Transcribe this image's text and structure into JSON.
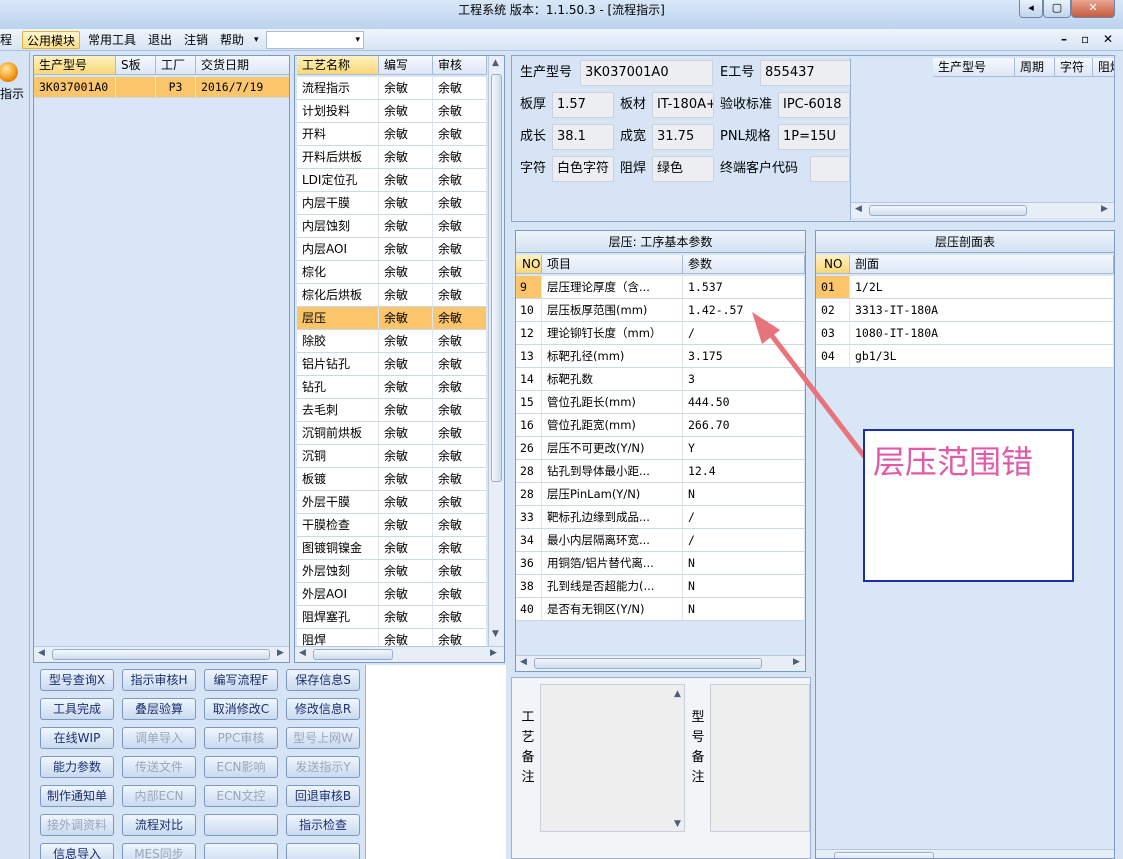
{
  "window": {
    "title": "工程系统  版本：1.1.50.3 - [流程指示]",
    "controls": [
      "◂",
      "▢",
      "✕"
    ]
  },
  "menu": {
    "items": [
      "程",
      "公用模块",
      "常用工具",
      "退出",
      "注销",
      "帮助"
    ],
    "combo_value": "",
    "mdi_controls": [
      "–",
      "▫",
      "✕"
    ]
  },
  "left_toolbar": {
    "label": "指示"
  },
  "order_table": {
    "columns": [
      "生产型号",
      "S板",
      "工厂",
      "交货日期"
    ],
    "rows": [
      [
        "3K037001A0",
        "",
        "P3",
        "2016/7/19"
      ]
    ]
  },
  "process_table": {
    "columns": [
      "工艺名称",
      "编写",
      "审核"
    ],
    "rows": [
      [
        "流程指示",
        "余敏",
        "余敏"
      ],
      [
        "计划投料",
        "余敏",
        "余敏"
      ],
      [
        "开料",
        "余敏",
        "余敏"
      ],
      [
        "开料后烘板",
        "余敏",
        "余敏"
      ],
      [
        "LDI定位孔",
        "余敏",
        "余敏"
      ],
      [
        "内层干膜",
        "余敏",
        "余敏"
      ],
      [
        "内层蚀刻",
        "余敏",
        "余敏"
      ],
      [
        "内层AOI",
        "余敏",
        "余敏"
      ],
      [
        "棕化",
        "余敏",
        "余敏"
      ],
      [
        "棕化后烘板",
        "余敏",
        "余敏"
      ],
      [
        "层压",
        "余敏",
        "余敏"
      ],
      [
        "除胶",
        "余敏",
        "余敏"
      ],
      [
        "铝片钻孔",
        "余敏",
        "余敏"
      ],
      [
        "钻孔",
        "余敏",
        "余敏"
      ],
      [
        "去毛刺",
        "余敏",
        "余敏"
      ],
      [
        "沉铜前烘板",
        "余敏",
        "余敏"
      ],
      [
        "沉铜",
        "余敏",
        "余敏"
      ],
      [
        "板镀",
        "余敏",
        "余敏"
      ],
      [
        "外层干膜",
        "余敏",
        "余敏"
      ],
      [
        "干膜检查",
        "余敏",
        "余敏"
      ],
      [
        "图镀铜镍金",
        "余敏",
        "余敏"
      ],
      [
        "外层蚀刻",
        "余敏",
        "余敏"
      ],
      [
        "外层AOI",
        "余敏",
        "余敏"
      ],
      [
        "阻焊塞孔",
        "余敏",
        "余敏"
      ],
      [
        "阻焊",
        "余敏",
        "余敏"
      ]
    ],
    "selected_index": 10
  },
  "buttons": [
    [
      "型号查询X",
      "指示审核H",
      "编写流程F",
      "保存信息S"
    ],
    [
      "工具完成",
      "叠层验算",
      "取消修改C",
      "修改信息R"
    ],
    [
      "在线WIP",
      "调单导入",
      "PPC审核",
      "型号上网W"
    ],
    [
      "能力参数",
      "传送文件",
      "ECN影响",
      "发送指示Y"
    ],
    [
      "制作通知单",
      "内部ECN",
      "ECN文控",
      "回退审核B"
    ],
    [
      "接外调资料",
      "流程对比",
      "",
      "指示检查"
    ],
    [
      "信息导入",
      "MES同步",
      "",
      ""
    ]
  ],
  "buttons_disabled": [
    [
      false,
      false,
      false,
      false
    ],
    [
      false,
      false,
      false,
      false
    ],
    [
      false,
      true,
      true,
      true
    ],
    [
      false,
      true,
      true,
      true
    ],
    [
      false,
      true,
      true,
      false
    ],
    [
      true,
      false,
      false,
      false
    ],
    [
      false,
      true,
      false,
      false
    ]
  ],
  "info": {
    "labels": {
      "model": "生产型号",
      "e_no": "E工号",
      "thickness": "板厚",
      "material": "板材",
      "standard": "验收标准",
      "length": "成长",
      "width": "成宽",
      "pnl": "PNL规格",
      "char": "字符",
      "mask": "阻焊",
      "end_customer": "终端客户代码"
    },
    "values": {
      "model": "3K037001A0",
      "e_no": "855437",
      "thickness": "1.57",
      "material": "IT-180A+",
      "standard": "IPC-6018",
      "length": "38.1",
      "width": "31.75",
      "pnl": "1P=15U",
      "char": "白色字符",
      "mask": "绿色",
      "end_customer": ""
    }
  },
  "right_table": {
    "columns": [
      "生产型号",
      "周期",
      "字符",
      "阻焊"
    ]
  },
  "param_table": {
    "title": "层压: 工序基本参数",
    "columns": [
      "NO",
      "项目",
      "参数"
    ],
    "rows": [
      [
        "9",
        "层压理论厚度（含...",
        "1.537"
      ],
      [
        "10",
        "层压板厚范围(mm)",
        "1.42-.57"
      ],
      [
        "12",
        "理论铆钉长度（mm）",
        "/"
      ],
      [
        "13",
        "标靶孔径(mm)",
        "3.175"
      ],
      [
        "14",
        "标靶孔数",
        "3"
      ],
      [
        "15",
        "管位孔距长(mm)",
        "444.50"
      ],
      [
        "16",
        "管位孔距宽(mm)",
        "266.70"
      ],
      [
        "26",
        "层压不可更改(Y/N)",
        "Y"
      ],
      [
        "28",
        "钻孔到导体最小距...",
        "12.4"
      ],
      [
        "28",
        "层压PinLam(Y/N)",
        "N"
      ],
      [
        "33",
        "靶标孔边缘到成品...",
        "/"
      ],
      [
        "34",
        "最小内层隔离环宽...",
        "/"
      ],
      [
        "36",
        "用铜箔/铝片替代离...",
        "N"
      ],
      [
        "38",
        "孔到线是否超能力(...",
        "N"
      ],
      [
        "40",
        "是否有无铜区(Y/N)",
        "N"
      ]
    ]
  },
  "section_table": {
    "title": "层压剖面表",
    "columns": [
      "NO",
      "剖面"
    ],
    "rows": [
      [
        "01",
        "1/2L"
      ],
      [
        "02",
        "3313-IT-180A"
      ],
      [
        "03",
        "1080-IT-180A"
      ],
      [
        "04",
        "gb1/3L"
      ]
    ]
  },
  "remarks": {
    "process_label": "工艺备注",
    "model_label": "型号备注"
  },
  "annotation": {
    "text": "层压范围错",
    "arrow_color": "#e8737a",
    "text_color": "#e25aa7",
    "border_color": "#1c2fa8"
  }
}
